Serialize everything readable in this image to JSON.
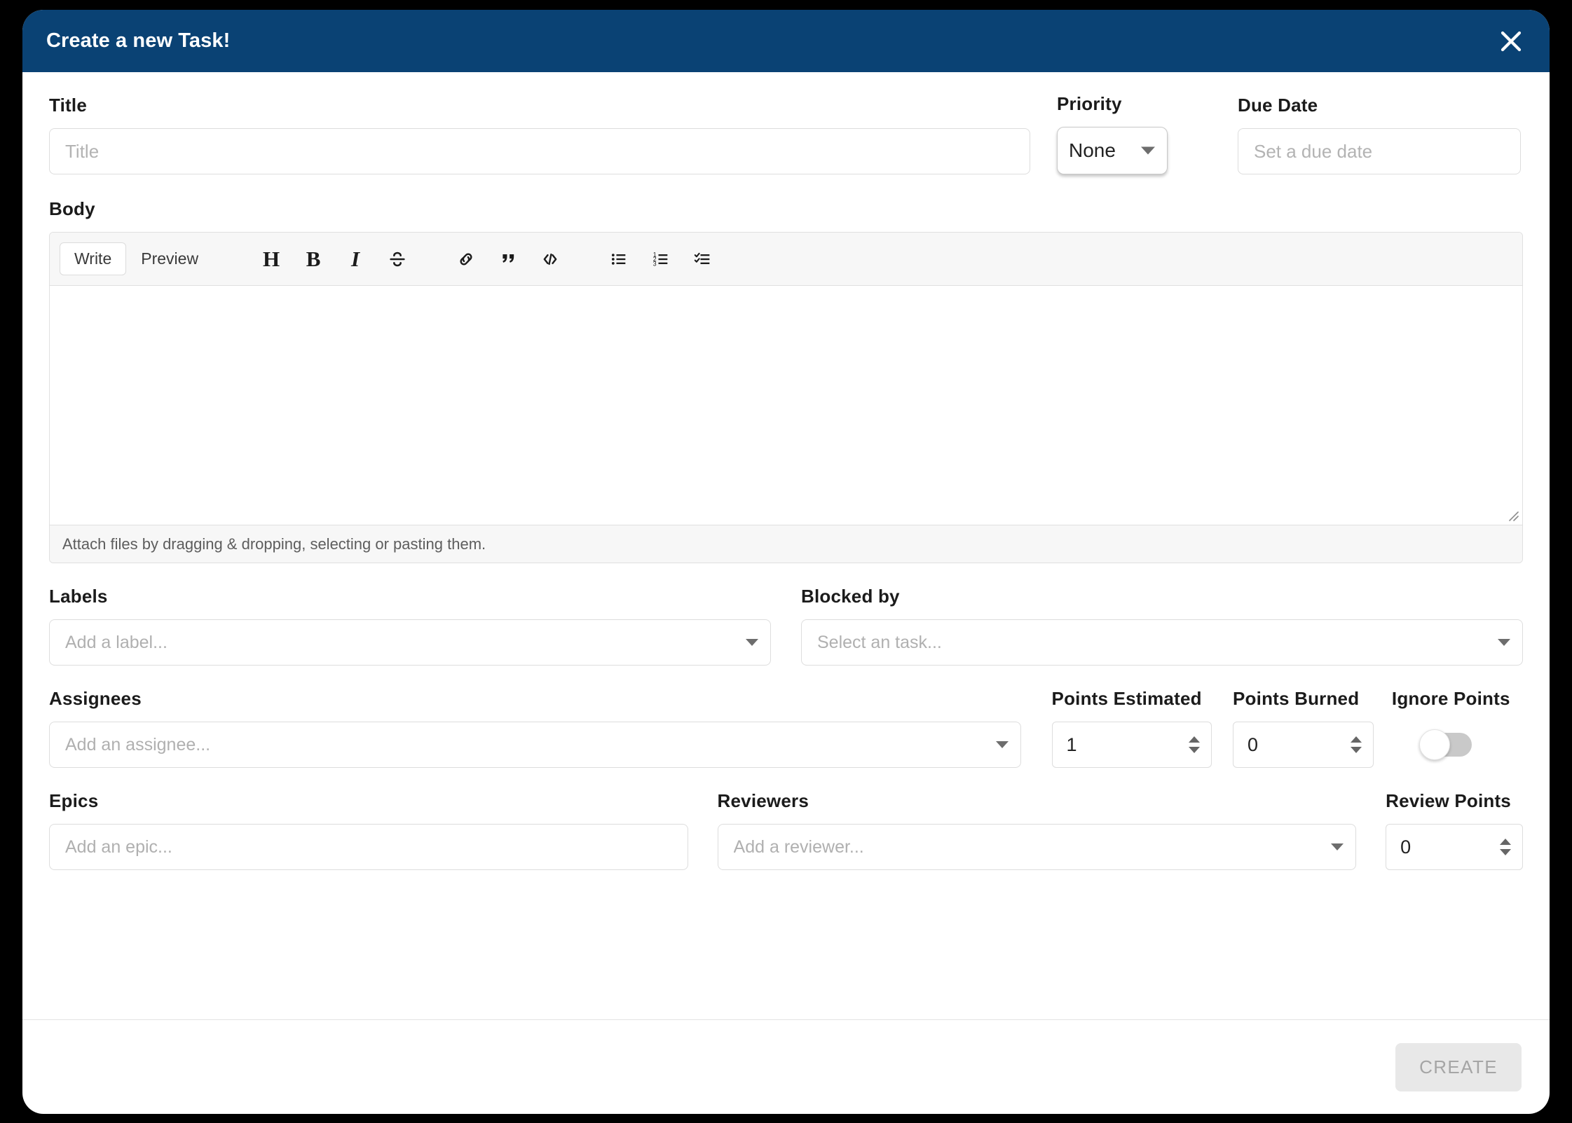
{
  "modal": {
    "title": "Create a new Task!",
    "close_icon": "close-icon",
    "header_color": "#0a4274"
  },
  "title_field": {
    "label": "Title",
    "placeholder": "Title",
    "value": ""
  },
  "priority_field": {
    "label": "Priority",
    "selected": "None"
  },
  "due_date_field": {
    "label": "Due Date",
    "placeholder": "Set a due date",
    "value": ""
  },
  "body_field": {
    "label": "Body",
    "value": "",
    "tabs": [
      {
        "label": "Write",
        "active": true
      },
      {
        "label": "Preview",
        "active": false
      }
    ],
    "tools": [
      {
        "name": "heading-icon",
        "glyph": "H"
      },
      {
        "name": "bold-icon",
        "glyph": "B"
      },
      {
        "name": "italic-icon",
        "glyph": "I"
      },
      {
        "name": "strikethrough-icon",
        "glyph": "S"
      },
      {
        "name": "link-icon",
        "glyph": "link"
      },
      {
        "name": "quote-icon",
        "glyph": "”"
      },
      {
        "name": "code-icon",
        "glyph": "</>"
      },
      {
        "name": "unordered-list-icon",
        "glyph": "ul"
      },
      {
        "name": "ordered-list-icon",
        "glyph": "ol"
      },
      {
        "name": "task-list-icon",
        "glyph": "tasks"
      }
    ],
    "attach_hint": "Attach files by dragging & dropping, selecting or pasting them."
  },
  "labels_field": {
    "label": "Labels",
    "placeholder": "Add a label...",
    "value": ""
  },
  "blocked_by_field": {
    "label": "Blocked by",
    "placeholder": "Select an task...",
    "value": ""
  },
  "assignees_field": {
    "label": "Assignees",
    "placeholder": "Add an assignee...",
    "value": ""
  },
  "points_estimated_field": {
    "label": "Points Estimated",
    "value": "1"
  },
  "points_burned_field": {
    "label": "Points Burned",
    "value": "0"
  },
  "ignore_points_field": {
    "label": "Ignore Points",
    "state": "off"
  },
  "epics_field": {
    "label": "Epics",
    "placeholder": "Add an epic...",
    "value": ""
  },
  "reviewers_field": {
    "label": "Reviewers",
    "placeholder": "Add a reviewer...",
    "value": ""
  },
  "review_points_field": {
    "label": "Review Points",
    "value": "0"
  },
  "footer": {
    "create_label": "CREATE"
  }
}
